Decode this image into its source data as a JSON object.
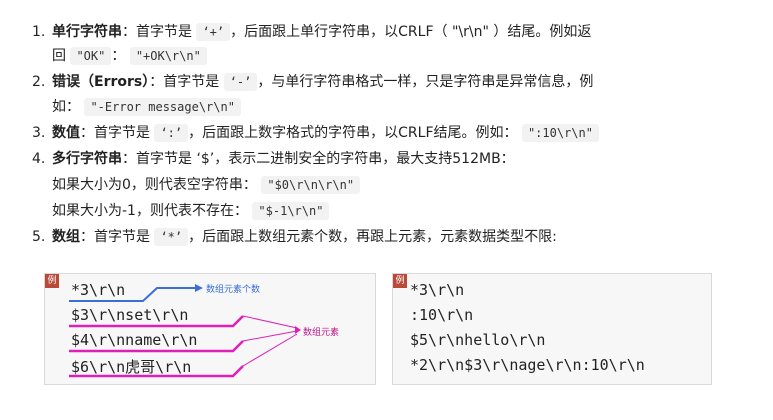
{
  "items": [
    {
      "num": "1.",
      "title": "单行字符串",
      "after_title": "：首字节是 ",
      "c1": "‘+’",
      "mid": "，后面跟上单行字符串，以CRLF（ \"\\r\\n\" ）结尾。例如返",
      "line2_prefix": "回 ",
      "c2": "\"OK\"",
      "line2_mid": "： ",
      "c3": "\"+OK\\r\\n\""
    },
    {
      "num": "2.",
      "title": "错误（Errors）",
      "after_title": "：首字节是 ",
      "c1": "‘-’",
      "mid": "，与单行字符串格式一样，只是字符串是异常信息，例",
      "line2_prefix": "如： ",
      "c2": "\"-Error message\\r\\n\""
    },
    {
      "num": "3.",
      "title": "数值",
      "after_title": "：首字节是 ",
      "c1": "‘:’",
      "mid": "，后面跟上数字格式的字符串，以CRLF结尾。例如： ",
      "c2": "\":10\\r\\n\""
    },
    {
      "num": "4.",
      "title": "多行字符串",
      "after_title": "：首字节是 ",
      "c1": "‘$’",
      "mid": "，表示二进制安全的字符串，最大支持512MB：",
      "l2": "如果大小为0，则代表空字符串： ",
      "c2": "\"$0\\r\\n\\r\\n\"",
      "l3": "如果大小为-1，则代表不存在： ",
      "c3": "\"$-1\\r\\n\""
    },
    {
      "num": "5.",
      "title": "数组",
      "after_title": "：首字节是 ",
      "c1": "‘*’",
      "mid": "，后面跟上数组元素个数，再跟上元素，元素数据类型不限:"
    }
  ],
  "panel_left": {
    "tag": "例",
    "lines": [
      "*3\\r\\n",
      "$3\\r\\nset\\r\\n",
      "$4\\r\\nname\\r\\n",
      "$6\\r\\n虎哥\\r\\n"
    ],
    "note_count": "数组元素个数",
    "note_elements": "数组元素"
  },
  "panel_right": {
    "tag": "例",
    "lines": [
      "*3\\r\\n",
      ":10\\r\\n",
      "$5\\r\\nhello\\r\\n",
      "*2\\r\\n$3\\r\\nage\\r\\n:10\\r\\n"
    ]
  },
  "colors": {
    "blue_annot": "#3a6fd8",
    "magenta_annot": "#e01fb8",
    "tag_red": "#b94a3a"
  }
}
